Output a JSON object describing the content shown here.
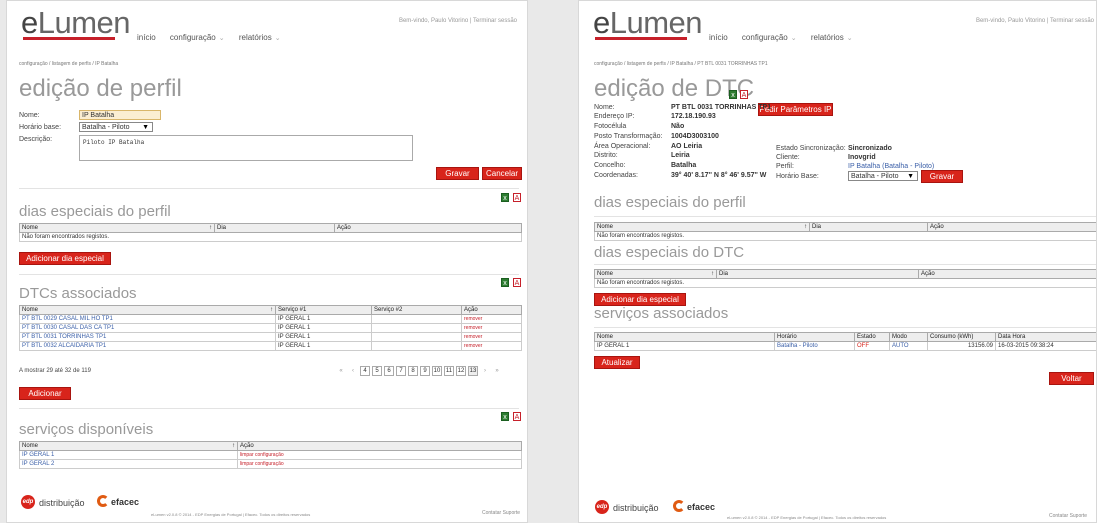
{
  "app": {
    "brand_e": "e",
    "brand_rest": "Lumen",
    "nav": [
      "início",
      "configuração",
      "relatórios"
    ],
    "user_text": "Bem-vindo, Paulo Vitorino | Terminar sessão",
    "contact": "Contatar Suporte",
    "footer": "eLumen v2.0.8 © 2014 - EDP Energias de Portugal | Efacec. Todos os direitos reservados",
    "distribuicao": "distribuição",
    "efacec": "efacec",
    "edp": "edp"
  },
  "left": {
    "breadcrumb": "configuração / listagem de perfis / IP Batalha",
    "title": "edição de perfil",
    "labels": {
      "nome": "Nome:",
      "horario": "Horário base:",
      "descricao": "Descrição:"
    },
    "values": {
      "nome": "IP Batalha",
      "horario": "Batalha - Piloto",
      "descricao": "Piloto IP Batalha"
    },
    "buttons": {
      "gravar": "Gravar",
      "cancelar": "Cancelar",
      "adicionar_dia": "Adicionar dia especial",
      "adicionar": "Adicionar"
    },
    "dias": {
      "title": "dias especiais do perfil",
      "headers": [
        "Nome",
        "Dia",
        "Ação"
      ],
      "empty": "Não foram encontrados registos."
    },
    "dtcs": {
      "title": "DTCs associados",
      "headers": [
        "Nome",
        "Serviço #1",
        "Serviço #2",
        "Ação"
      ],
      "rows": [
        [
          "PT BTL 0029 CASAL MIL HO TP1",
          "IP GERAL 1",
          "",
          "remover"
        ],
        [
          "PT BTL 0030 CASAL DAS CA TP1",
          "IP GERAL 1",
          "",
          "remover"
        ],
        [
          "PT BTL 0031 TORRINHAS TP1",
          "IP GERAL 1",
          "",
          "remover"
        ],
        [
          "PT BTL 0032 ALCAIDARIA TP1",
          "IP GERAL 1",
          "",
          "remover"
        ]
      ],
      "showing": "A mostrar 29 até 32 de 119",
      "pages": [
        "«",
        "‹",
        "4",
        "5",
        "6",
        "7",
        "8",
        "9",
        "10",
        "11",
        "12",
        "13",
        "›",
        "»"
      ]
    },
    "servicos": {
      "title": "serviços disponíveis",
      "headers": [
        "Nome",
        "Ação"
      ],
      "rows": [
        [
          "IP GERAL 1",
          "limpar configuração"
        ],
        [
          "IP GERAL 2",
          "limpar configuração"
        ]
      ]
    }
  },
  "right": {
    "breadcrumb": "configuração / listagem de perfis / IP Batalha / PT BTL 0031 TORRINHAS TP1",
    "title": "edição de DTC",
    "pedir_btn": "Pedir Parâmetros IP",
    "fields": [
      {
        "label": "Nome:",
        "value": "PT BTL 0031 TORRINHAS TP1"
      },
      {
        "label": "Endereço IP:",
        "value": "172.18.190.93"
      },
      {
        "label": "Fotocélula",
        "value": "Não"
      },
      {
        "label": "Posto Transformação:",
        "value": "1004D3003100"
      },
      {
        "label": "Área Operacional:",
        "value": "AO Leiria"
      },
      {
        "label": "Distrito:",
        "value": "Leiria"
      },
      {
        "label": "Concelho:",
        "value": "Batalha"
      },
      {
        "label": "Coordenadas:",
        "value": "39° 40' 8.17'' N  8° 46' 9.57'' W"
      }
    ],
    "fields2": [
      {
        "label": "Estado Sincronização:",
        "value": "Sincronizado"
      },
      {
        "label": "Cliente:",
        "value": "Inovgrid"
      },
      {
        "label": "Perfil:",
        "value": "IP Batalha (Batalha - Piloto)"
      },
      {
        "label": "Horário Base:",
        "value": "Batalha - Piloto"
      }
    ],
    "gravar": "Gravar",
    "dias_perfil": {
      "title": "dias especiais do perfil",
      "headers": [
        "Nome",
        "Dia",
        "Ação"
      ],
      "empty": "Não foram encontrados registos."
    },
    "dias_dtc": {
      "title": "dias especiais do DTC",
      "headers": [
        "Nome",
        "Dia",
        "Ação"
      ],
      "empty": "Não foram encontrados registos."
    },
    "adicionar_dia": "Adicionar dia especial",
    "servicos": {
      "title": "serviços associados",
      "headers": [
        "Nome",
        "Horário",
        "Estado",
        "Modo",
        "Consumo (kWh)",
        "Data Hora"
      ],
      "rows": [
        [
          "IP GERAL 1",
          "Batalha - Piloto",
          "OFF",
          "AUTO",
          "13156.09",
          "16-03-2015 09:38:24"
        ]
      ]
    },
    "atualizar": "Atualizar",
    "voltar": "Voltar"
  }
}
